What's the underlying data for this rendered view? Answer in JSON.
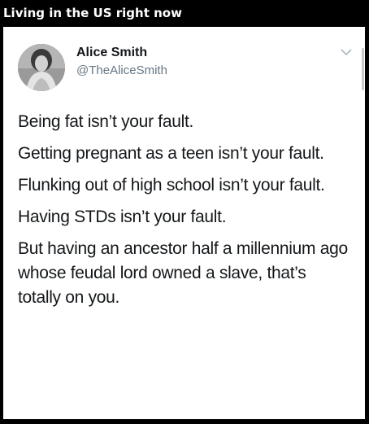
{
  "caption": "Living in the US right now",
  "tweet": {
    "author_name": "Alice Smith",
    "author_handle": "@TheAliceSmith",
    "menu_icon": "chevron-down-icon",
    "paragraphs": [
      "Being fat isn’t your fault.",
      "Getting pregnant as a teen isn’t your fault.",
      "Flunking out of high school isn’t your fault.",
      "Having STDs isn’t your fault.",
      "But having an ancestor half a millennium ago whose feudal lord owned a slave, that’s totally on you."
    ]
  }
}
